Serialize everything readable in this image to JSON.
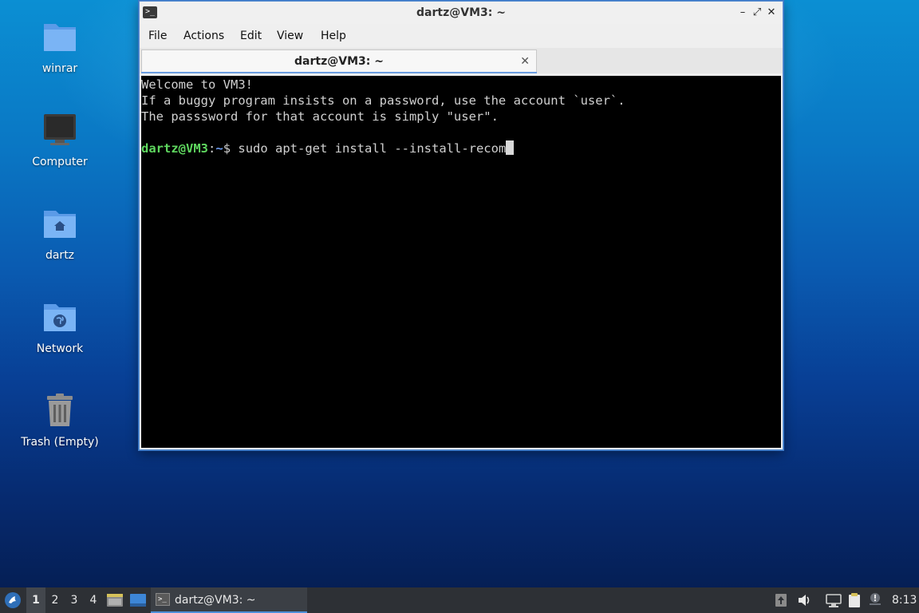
{
  "desktop": {
    "icons": [
      {
        "label": "winrar"
      },
      {
        "label": "Computer"
      },
      {
        "label": "dartz"
      },
      {
        "label": "Network"
      },
      {
        "label": "Trash (Empty)"
      }
    ]
  },
  "window": {
    "title": "dartz@VM3: ~",
    "app_icon": ">_",
    "buttons": {
      "minimize": "–",
      "maximize": "⤢",
      "close": "✕"
    },
    "menu": [
      "File",
      "Actions",
      "Edit",
      "View",
      "Help"
    ],
    "tab": {
      "title": "dartz@VM3: ~",
      "close": "✕"
    },
    "terminal": {
      "lines": [
        "Welcome to VM3!",
        "If a buggy program insists on a password, use the account `user`.",
        "The passsword for that account is simply \"user\"."
      ],
      "prompt_user": "dartz@VM3",
      "prompt_colon": ":",
      "prompt_path": "~",
      "prompt_symbol": "$ ",
      "command": "sudo apt-get install --install-recom"
    }
  },
  "taskbar": {
    "workspaces": [
      "1",
      "2",
      "3",
      "4"
    ],
    "active_workspace": "1",
    "task": {
      "label": "dartz@VM3: ~",
      "icon": ">_"
    },
    "clock": "8:13",
    "tray_icons": [
      "update-notifier-icon",
      "volume-icon",
      "network-icon",
      "clipboard-icon",
      "notification-icon"
    ],
    "colors": {
      "accent": "#4d8fd9",
      "panel": "#2d3035"
    }
  }
}
